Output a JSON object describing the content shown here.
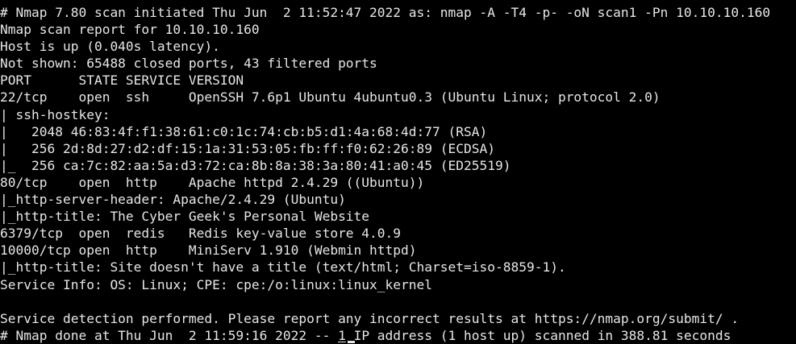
{
  "colors": {
    "background": "#000000",
    "text": "#e6e6e6"
  },
  "output": {
    "line_01": "# Nmap 7.80 scan initiated Thu Jun  2 11:52:47 2022 as: nmap -A -T4 -p- -oN scan1 -Pn 10.10.10.160",
    "line_02": "Nmap scan report for 10.10.10.160",
    "line_03": "Host is up (0.040s latency).",
    "line_04": "Not shown: 65488 closed ports, 43 filtered ports",
    "line_05": "PORT      STATE SERVICE VERSION",
    "line_06": "22/tcp    open  ssh     OpenSSH 7.6p1 Ubuntu 4ubuntu0.3 (Ubuntu Linux; protocol 2.0)",
    "line_07": "| ssh-hostkey: ",
    "line_08": "|   2048 46:83:4f:f1:38:61:c0:1c:74:cb:b5:d1:4a:68:4d:77 (RSA)",
    "line_09": "|   256 2d:8d:27:d2:df:15:1a:31:53:05:fb:ff:f0:62:26:89 (ECDSA)",
    "line_10": "|_  256 ca:7c:82:aa:5a:d3:72:ca:8b:8a:38:3a:80:41:a0:45 (ED25519)",
    "line_11": "80/tcp    open  http    Apache httpd 2.4.29 ((Ubuntu))",
    "line_12": "|_http-server-header: Apache/2.4.29 (Ubuntu)",
    "line_13": "|_http-title: The Cyber Geek's Personal Website",
    "line_14": "6379/tcp  open  redis   Redis key-value store 4.0.9",
    "line_15": "10000/tcp open  http    MiniServ 1.910 (Webmin httpd)",
    "line_16": "|_http-title: Site doesn't have a title (text/html; Charset=iso-8859-1).",
    "line_17": "Service Info: OS: Linux; CPE: cpe:/o:linux:linux_kernel",
    "line_18": "",
    "line_19": "Service detection performed. Please report any incorrect results at https://nmap.org/submit/ .",
    "line_20_prefix": "# Nmap done at Thu Jun  2 11:59:16 2022 -- ",
    "line_20_count": "1",
    "line_20_suffix": " IP address (1 host up) scanned in 388.81 seconds"
  }
}
